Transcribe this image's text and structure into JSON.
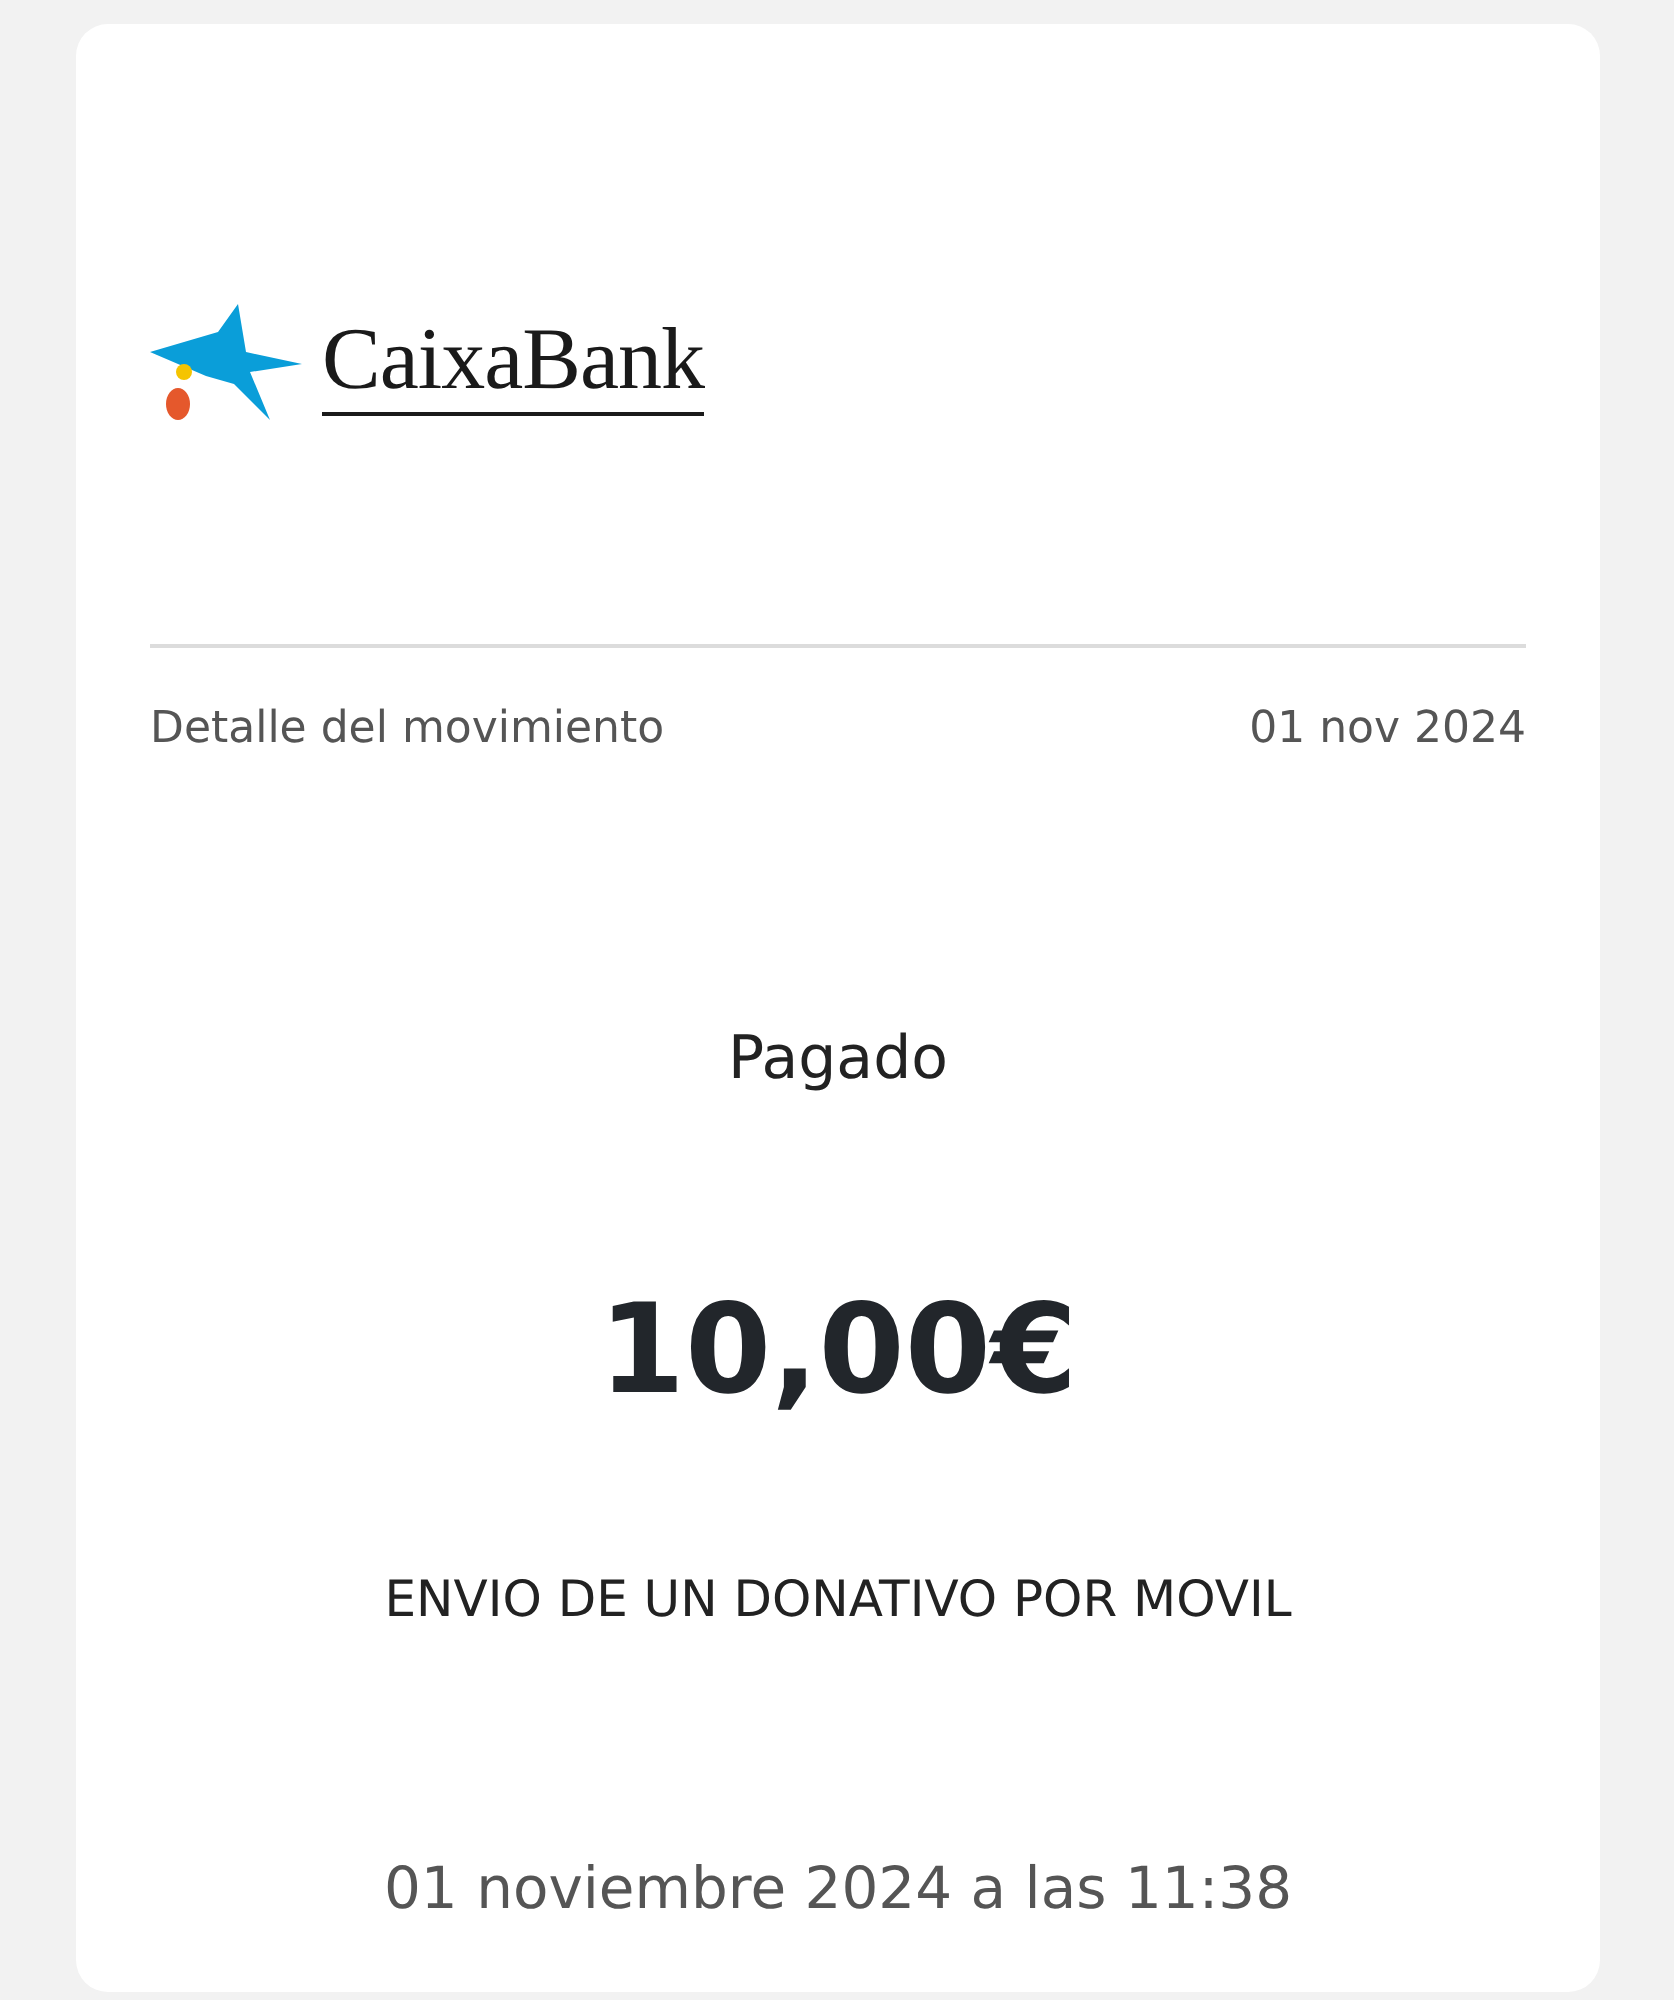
{
  "logo": {
    "text": "CaixaBank"
  },
  "header": {
    "title": "Detalle del movimiento",
    "date": "01 nov 2024"
  },
  "status": "Pagado",
  "amount": "10,00€",
  "concept": "ENVIO DE UN DONATIVO POR MOVIL",
  "datetime": "01 noviembre 2024 a las 11:38"
}
